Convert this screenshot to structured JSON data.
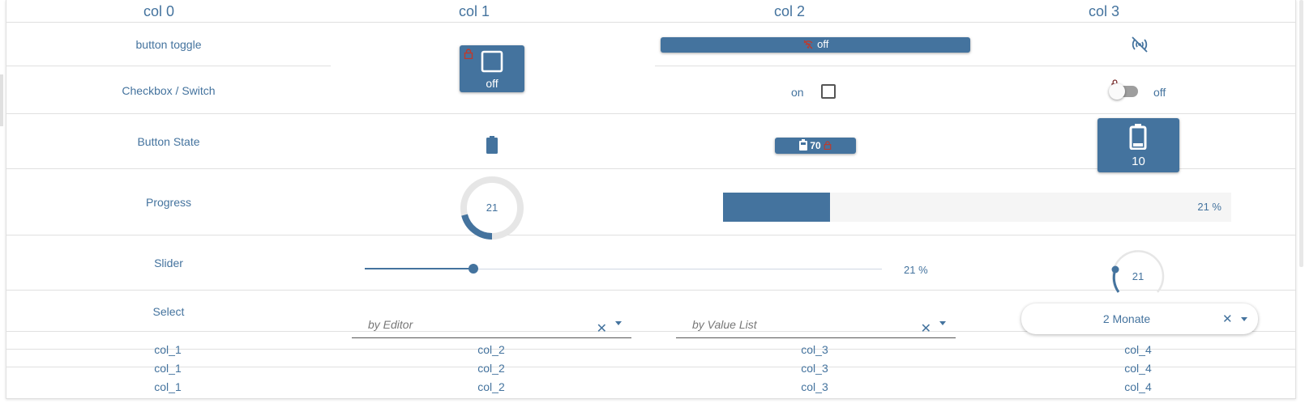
{
  "headers": [
    "col 0",
    "col 1",
    "col 2",
    "col 3"
  ],
  "rows": {
    "button_toggle": {
      "label": "button toggle",
      "col1_text": "off",
      "col2_text": "off"
    },
    "checkbox_switch": {
      "label": "Checkbox / Switch",
      "col2_text": "on",
      "col3_text": "off",
      "checkbox_checked": false,
      "switch_on": false
    },
    "button_state": {
      "label": "Button State",
      "col2_value": "70",
      "col3_value": "10"
    },
    "progress": {
      "label": "Progress",
      "circle_value": "21",
      "bar_text": "21 %",
      "percent": 21
    },
    "slider": {
      "label": "Slider",
      "value_text": "21 %",
      "knob_value": "21",
      "percent": 21
    },
    "select": {
      "label": "Select",
      "col1_placeholder": "by Editor",
      "col2_placeholder": "by Value List",
      "col3_value": "2 Monate",
      "clear_symbol": "✕"
    }
  },
  "table": [
    [
      "col_1",
      "col_2",
      "col_3",
      "col_4"
    ],
    [
      "col_1",
      "col_2",
      "col_3",
      "col_4"
    ],
    [
      "col_1",
      "col_2",
      "col_3",
      "col_4"
    ]
  ],
  "colors": {
    "primary": "#44739e",
    "lock": "#c0392b",
    "track": "#e6e6e6",
    "divider": "#e0e0e0"
  }
}
